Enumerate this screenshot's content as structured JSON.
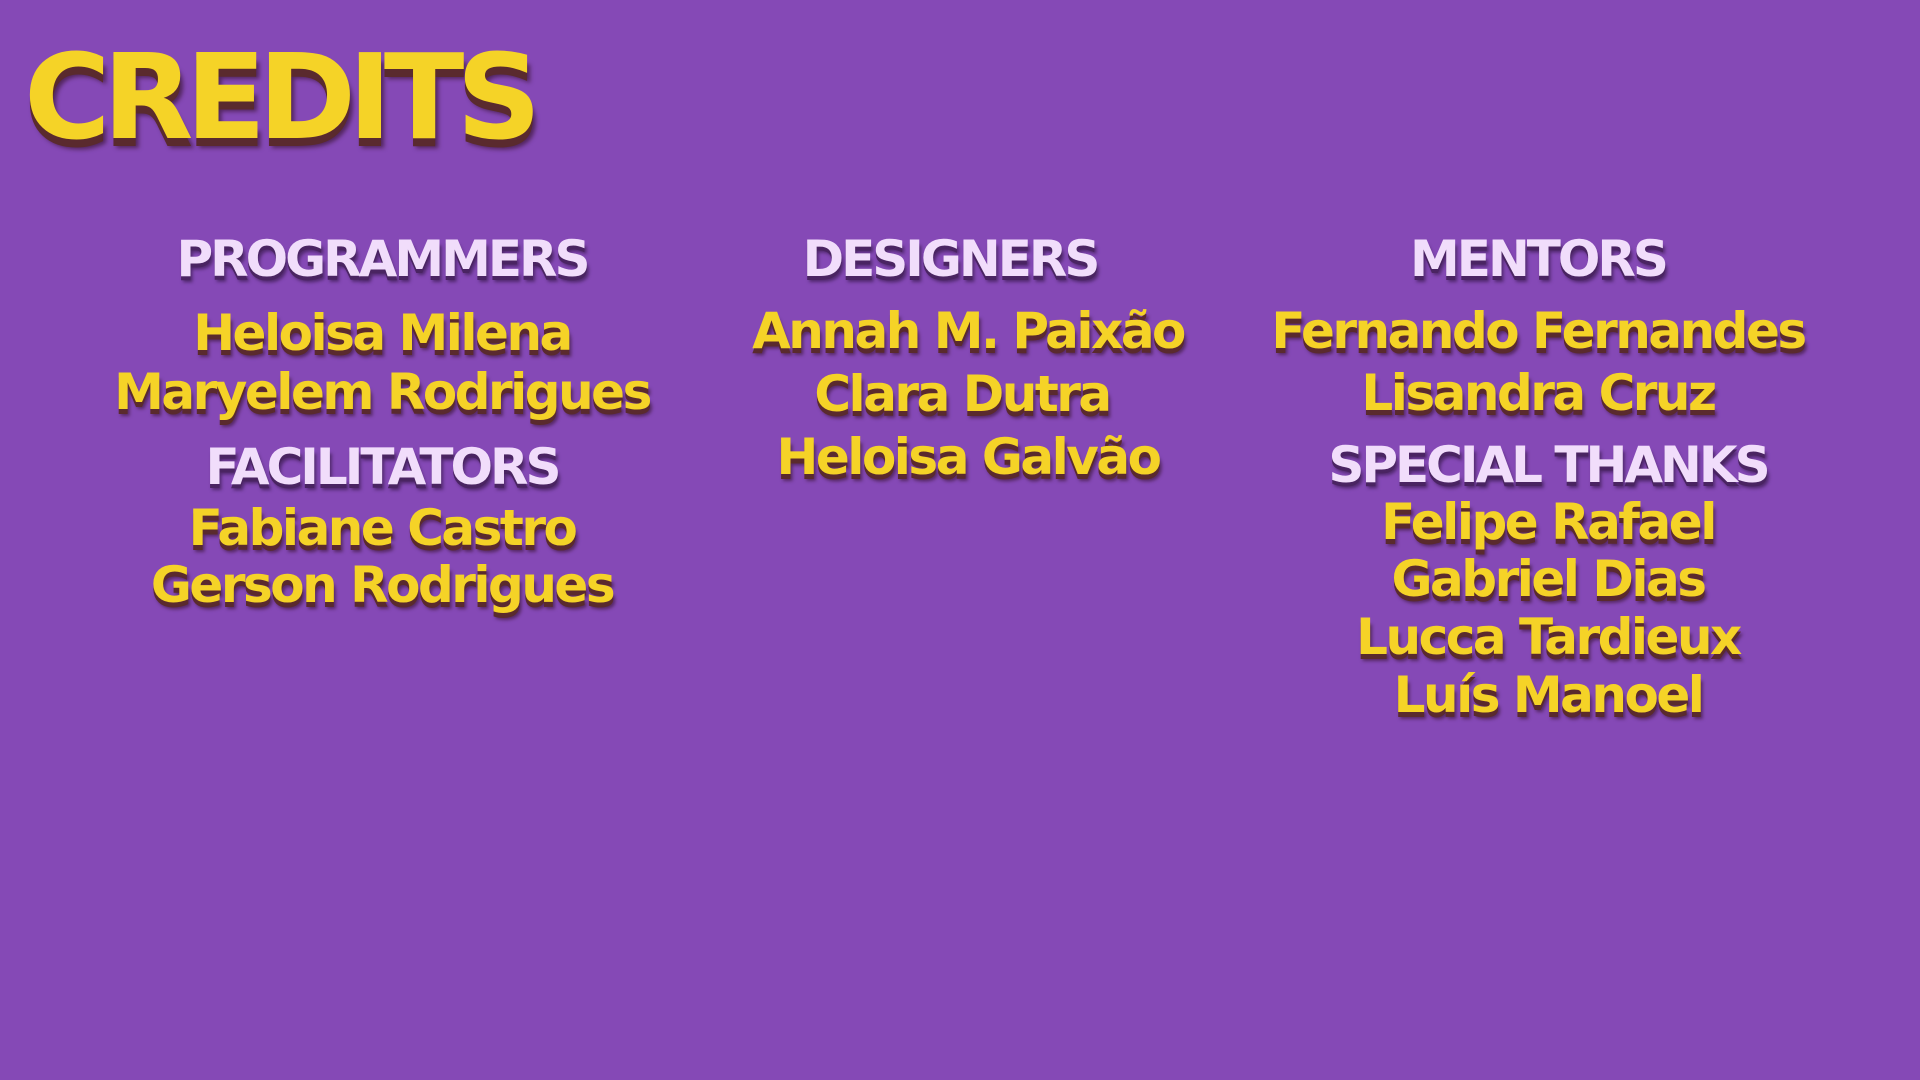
{
  "title": "CREDITS",
  "programmers": {
    "heading": "PROGRAMMERS",
    "names": [
      "Heloisa Milena",
      "Maryelem Rodrigues"
    ]
  },
  "facilitators": {
    "heading": "FACILITATORS",
    "names": [
      "Fabiane Castro",
      "Gerson Rodrigues"
    ]
  },
  "designers": {
    "heading": "DESIGNERS",
    "names": [
      "Annah M. Paixão",
      "Clara Dutra",
      "Heloisa Galvão"
    ]
  },
  "mentors": {
    "heading": "MENTORS",
    "names": [
      "Fernando Fernandes",
      "Lisandra Cruz"
    ]
  },
  "special_thanks": {
    "heading": "SPECIAL THANKS",
    "names": [
      "Felipe Rafael",
      "Gabriel Dias",
      "Lucca Tardieux",
      "Luís Manoel"
    ]
  },
  "colors": {
    "background": "#8549b6",
    "name_text": "#f5d327",
    "heading_text": "#f1ddfb"
  }
}
